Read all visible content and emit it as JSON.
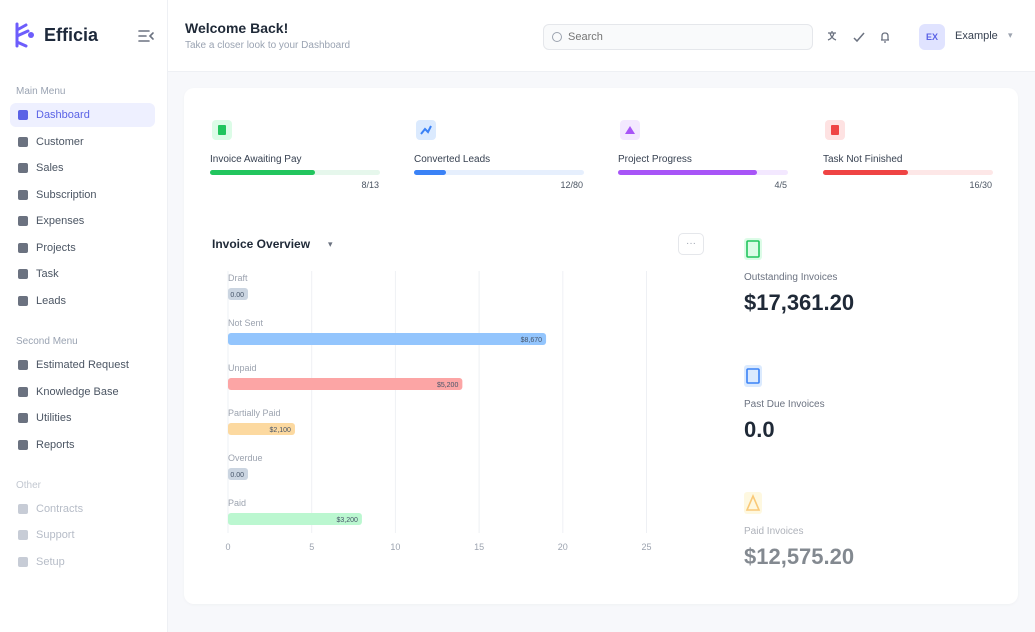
{
  "brand": {
    "name": "Efficia"
  },
  "sidebar": {
    "main_title": "Main Menu",
    "main_items": [
      "Dashboard",
      "Customer",
      "Sales",
      "Subscription",
      "Expenses",
      "Projects",
      "Task",
      "Leads"
    ],
    "second_title": "Second Menu",
    "second_items": [
      "Estimated Request",
      "Knowledge Base",
      "Utilities",
      "Reports"
    ],
    "other_title": "Other",
    "other_items": [
      "Contracts",
      "Support",
      "Setup"
    ]
  },
  "header": {
    "title": "Welcome Back!",
    "subtitle": "Take a closer look to your Dashboard",
    "search_placeholder": "Search",
    "user_initials": "EX",
    "user_name": "Example"
  },
  "stats": [
    {
      "label": "Invoice Awaiting Pay",
      "value": "8/13",
      "progress": 0.62,
      "color": "#22c55e",
      "track": "#e6f7ec"
    },
    {
      "label": "Converted Leads",
      "value": "12/80",
      "progress": 0.19,
      "color": "#3b82f6",
      "track": "#e6effd"
    },
    {
      "label": "Project Progress",
      "value": "4/5",
      "progress": 0.82,
      "color": "#a855f7",
      "track": "#f3e8ff"
    },
    {
      "label": "Task Not Finished",
      "value": "16/30",
      "progress": 0.5,
      "color": "#ef4444",
      "track": "#fde7e7"
    }
  ],
  "chart": {
    "title": "Invoice Overview",
    "more_label": "···"
  },
  "chart_data": {
    "type": "bar",
    "categories": [
      "Draft",
      "Not Sent",
      "Unpaid",
      "Partially Paid",
      "Overdue",
      "Paid"
    ],
    "values": [
      0,
      19,
      14,
      4,
      0,
      8
    ],
    "value_labels": [
      "0.00",
      "$8,670",
      "$5,200",
      "$2,100",
      "0.00",
      "$3,200"
    ],
    "colors": [
      "#cbd5e1",
      "#93c5fd",
      "#fca5a5",
      "#fcd9a0",
      "#cbd5e1",
      "#bbf7d0"
    ],
    "xlim": [
      0,
      27
    ],
    "xticks": [
      "0",
      "5",
      "10",
      "15",
      "20",
      "25"
    ]
  },
  "summaries": [
    {
      "label": "Outstanding Invoices",
      "value": "$17,361.20",
      "color": "#22c55e",
      "icon": "invoice-icon"
    },
    {
      "label": "Past Due Invoices",
      "value": "0.0",
      "color": "#3b82f6",
      "icon": "calendar-icon"
    },
    {
      "label": "Paid Invoices",
      "value": "$12,575.20",
      "color": "#f59e0b",
      "icon": "receipt-icon"
    }
  ]
}
